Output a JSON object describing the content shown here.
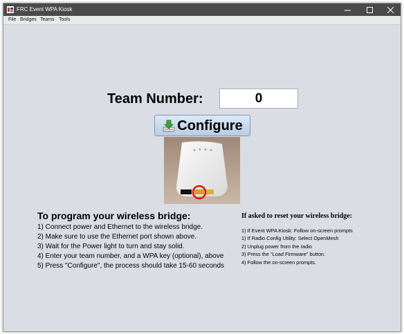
{
  "window": {
    "title": "FRC Event WPA Kiosk",
    "controls": {
      "minimize": "—",
      "maximize": "☐",
      "close": "✕"
    }
  },
  "menu": [
    "File",
    "Bridges",
    "Teams",
    "Tools"
  ],
  "team": {
    "label": "Team Number:",
    "value": "0"
  },
  "configure": {
    "label": "Configure",
    "icon": "download-icon"
  },
  "image": {
    "alt": "wireless bridge ethernet port",
    "highlight": "red-circle"
  },
  "instructions": {
    "title": "To program your wireless bridge:",
    "steps": [
      "1) Connect power and Ethernet to the wireless bridge.",
      "2) Make sure to use the Ethernet port shown above.",
      "3) Wait for the Power light to turn and stay solid.",
      "4) Enter your team number, and a WPA key (optional), above",
      "5) Press \"Configure\", the process should take 15-60 seconds"
    ]
  },
  "reset": {
    "title": "If asked to reset your wireless bridge:",
    "steps": [
      "1) If Event WPA Kiosk: Follow on-screen prompts",
      "1) If Radio Config Utility: Select OpenMesh",
      "2) Unplug power from the radio",
      "3) Press the \"Load Firmware\" button.",
      "4) Follow the on-screen prompts."
    ]
  },
  "colors": {
    "titlebar": "#4a4a4a",
    "background": "#dadde4",
    "button": "#c8dbee",
    "highlight": "#e01010"
  }
}
